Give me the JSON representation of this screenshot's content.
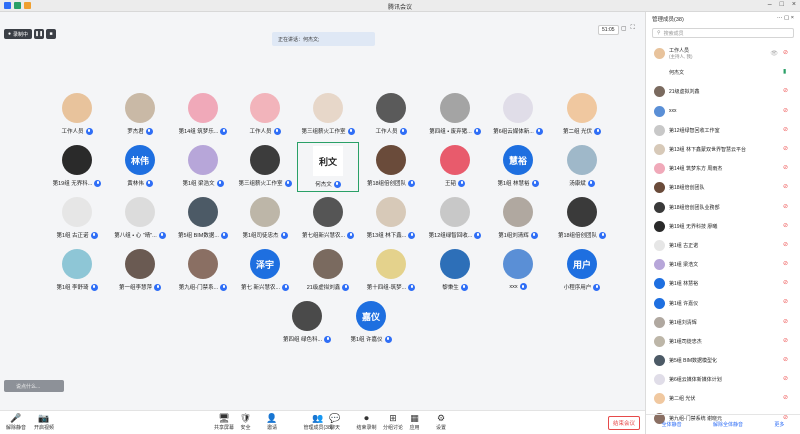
{
  "app": {
    "title": "腾讯会议"
  },
  "meeting": {
    "recording_label": "录制中",
    "speaking_text": "正在讲话：何杰文;",
    "timer": "51:05",
    "chat_placeholder": "说点什么..."
  },
  "participants_grid": [
    {
      "name": "工作人员",
      "color": "#e8c39c",
      "text": ""
    },
    {
      "name": "罗杰君",
      "color": "#c9b9a6",
      "text": ""
    },
    {
      "name": "第14组 筑梦乐...",
      "color": "#f0a9b9",
      "text": ""
    },
    {
      "name": "工作人员",
      "color": "#f2b4bb",
      "text": ""
    },
    {
      "name": "第三组薪火工作室",
      "color": "#e7d7c9",
      "text": ""
    },
    {
      "name": "工作人员",
      "color": "#5a5a5a",
      "text": ""
    },
    {
      "name": "第四组 • 废弃猪...",
      "color": "#a4a4a4",
      "text": ""
    },
    {
      "name": "第6组云媒体新...",
      "color": "#e0dde8",
      "text": ""
    },
    {
      "name": "第二组 光伏",
      "color": "#f0c8a0",
      "text": ""
    },
    {
      "name": "第19组 无界科...",
      "color": "#2a2a2a",
      "text": ""
    },
    {
      "name": "黄林伟",
      "color": "#1e6fe0",
      "text": "林伟"
    },
    {
      "name": "第1组 梁浩文",
      "color": "#b7a6d9",
      "text": ""
    },
    {
      "name": "第三组薪火工作室",
      "color": "#3c3c3c",
      "text": ""
    },
    {
      "name": "何杰文",
      "color": "#ffffff",
      "text": "",
      "active": true
    },
    {
      "name": "第18组倍创团队",
      "color": "#6a4b3a",
      "text": ""
    },
    {
      "name": "王韬",
      "color": "#e85b6c",
      "text": ""
    },
    {
      "name": "第1组 林慧裕",
      "color": "#1e6fe0",
      "text": "慧裕"
    },
    {
      "name": "汤康斌",
      "color": "#9fb8c9",
      "text": ""
    },
    {
      "name": "第1组 古正诺",
      "color": "#e6e6e6",
      "text": ""
    },
    {
      "name": "第八组 • 心 \"晴\"...",
      "color": "#dcdcdc",
      "text": ""
    },
    {
      "name": "第5组 BIM数据...",
      "color": "#4c5a66",
      "text": ""
    },
    {
      "name": "第1组司徒忠杰",
      "color": "#bdb6a8",
      "text": ""
    },
    {
      "name": "第七组新兴慧农...",
      "color": "#555555",
      "text": ""
    },
    {
      "name": "第13组 林下鑫...",
      "color": "#d7c9b8",
      "text": ""
    },
    {
      "name": "第12组绿智回收...",
      "color": "#c8c8c8",
      "text": ""
    },
    {
      "name": "第1组刘清辉",
      "color": "#b0a8a0",
      "text": ""
    },
    {
      "name": "第18组倍创团队",
      "color": "#3a3a3a",
      "text": ""
    },
    {
      "name": "第1组 李舒琦",
      "color": "#8ec6d6",
      "text": ""
    },
    {
      "name": "第一组李慧萍",
      "color": "#6a5a52",
      "text": ""
    },
    {
      "name": "第九组-门禁系...",
      "color": "#8a6f63",
      "text": ""
    },
    {
      "name": "第七 新兴慧农...",
      "color": "#1e6fe0",
      "text": "泽宇"
    },
    {
      "name": "21级虚拟刘鑫",
      "color": "#7a6a5f",
      "text": ""
    },
    {
      "name": "第十四组-筑梦...",
      "color": "#e4d28c",
      "text": ""
    },
    {
      "name": "黎秉生",
      "color": "#2d6fb8",
      "text": ""
    },
    {
      "name": "xxx",
      "color": "#5a8fd6",
      "text": ""
    },
    {
      "name": "小程序用户",
      "color": "#1e6fe0",
      "text": "用户"
    },
    {
      "name": "第四组 绿色科...",
      "color": "#4a4a4a",
      "text": ""
    },
    {
      "name": "第1组 许嘉仪",
      "color": "#1e6fe0",
      "text": "嘉仪"
    }
  ],
  "toolbar": {
    "mute": "解除静音",
    "video": "开启视频",
    "items": [
      "共享屏幕",
      "安全",
      "邀请",
      "管理成员(38)",
      "聊天",
      "结束录制",
      "分组讨论",
      "应用",
      "设置"
    ],
    "end": "结束会议"
  },
  "panel": {
    "title": "管理成员(38)",
    "search_placeholder": "搜索成员",
    "members": [
      {
        "name": "工作人员",
        "sub": "(主持人, 我)",
        "color": "#e8c39c",
        "mic": "off"
      },
      {
        "name": "何杰文",
        "sub": "",
        "color": "#ffffff",
        "mic": "on"
      },
      {
        "name": "21级虚拟刘鑫",
        "sub": "",
        "color": "#7a6a5f",
        "mic": "off"
      },
      {
        "name": "xxx",
        "sub": "",
        "color": "#5a8fd6",
        "mic": "off"
      },
      {
        "name": "第12组绿智回收工作室",
        "sub": "",
        "color": "#c8c8c8",
        "mic": "off"
      },
      {
        "name": "第13组 林下鑫蒙双世界智慧云平台",
        "sub": "",
        "color": "#d7c9b8",
        "mic": "off"
      },
      {
        "name": "第14组 筑梦东方 周雨杰",
        "sub": "",
        "color": "#f0a9b9",
        "mic": "off"
      },
      {
        "name": "第18组倍创团队",
        "sub": "",
        "color": "#6a4b3a",
        "mic": "off"
      },
      {
        "name": "第18组倍创团队业務部",
        "sub": "",
        "color": "#3a3a3a",
        "mic": "off"
      },
      {
        "name": "第19组 无界科技 廖曦",
        "sub": "",
        "color": "#2a2a2a",
        "mic": "off"
      },
      {
        "name": "第1组 古正诺",
        "sub": "",
        "color": "#e6e6e6",
        "mic": "off"
      },
      {
        "name": "第1组 梁浩文",
        "sub": "",
        "color": "#b7a6d9",
        "mic": "off"
      },
      {
        "name": "第1组 林慧裕",
        "sub": "",
        "color": "#1e6fe0",
        "mic": "off"
      },
      {
        "name": "第1组 许嘉仪",
        "sub": "",
        "color": "#1e6fe0",
        "mic": "off"
      },
      {
        "name": "第1组刘清辉",
        "sub": "",
        "color": "#b0a8a0",
        "mic": "off"
      },
      {
        "name": "第1组司徒忠杰",
        "sub": "",
        "color": "#bdb6a8",
        "mic": "off"
      },
      {
        "name": "第5组 BIM数据模型化",
        "sub": "",
        "color": "#4c5a66",
        "mic": "off"
      },
      {
        "name": "第6组云媒体新媒体计划",
        "sub": "",
        "color": "#e0dde8",
        "mic": "off"
      },
      {
        "name": "第二组 光伏",
        "sub": "",
        "color": "#f0c8a0",
        "mic": "off"
      },
      {
        "name": "第九组-门禁系统 谢晓元",
        "sub": "",
        "color": "#8a6f63",
        "mic": "off"
      }
    ],
    "footer": [
      "全体静音",
      "解除全体静音",
      "更多"
    ]
  }
}
